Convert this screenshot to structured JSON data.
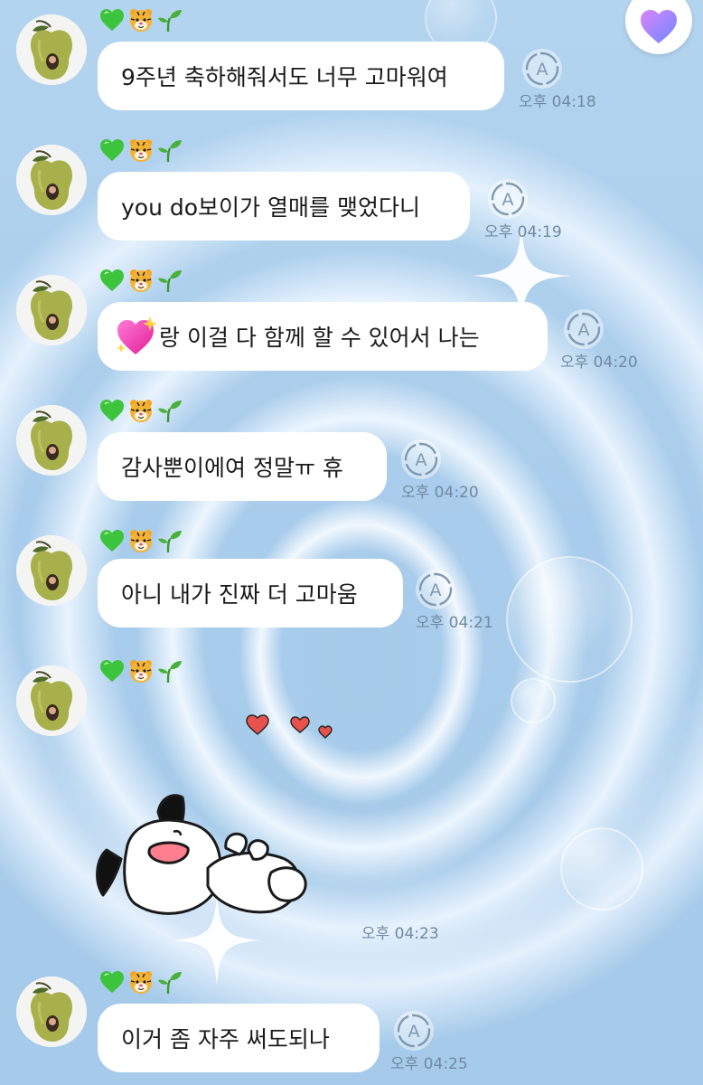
{
  "header": {
    "heart_button": "heart-icon"
  },
  "sender_emojis": [
    "green-heart-icon",
    "tiger-face-icon",
    "seedling-icon"
  ],
  "messages": [
    {
      "text": "9주년 축하해줘서도 너무 고마워여",
      "time": "오후 04:18"
    },
    {
      "text": "you do보이가 열매를 맺었다니",
      "time": "오후 04:19"
    },
    {
      "emoji": "sparkling-heart-icon",
      "text": "랑 이걸 다 함께 할 수 있어서 나는",
      "time": "오후 04:20"
    },
    {
      "text": "감사뿐이에여 정말ㅠ 휴",
      "time": "오후 04:20"
    },
    {
      "text": "아니 내가 진짜 더 고마움",
      "time": "오후 04:21"
    },
    {
      "sticker": "dog-sticker",
      "time": "오후 04:23"
    },
    {
      "text": "이거 좀 자주 써도되나",
      "time": "오후 04:25"
    }
  ],
  "colors": {
    "background": "#a9cdeb",
    "bubble": "#ffffff",
    "time_text": "#6f8aa3",
    "heart_button": "#b07cf2"
  }
}
